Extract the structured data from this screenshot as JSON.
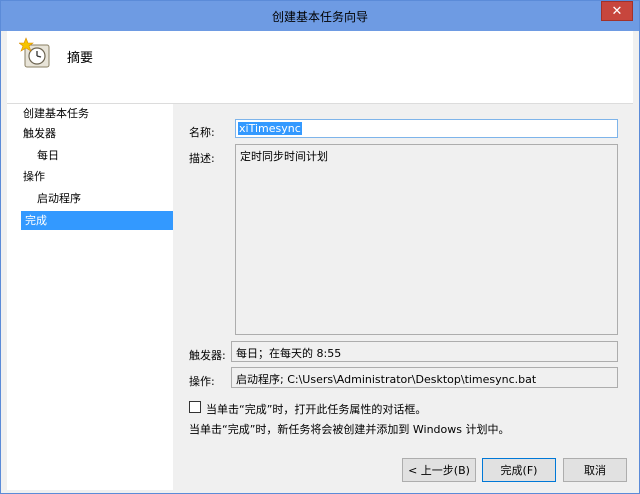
{
  "window": {
    "title": "创建基本任务向导",
    "close_symbol": "✕"
  },
  "header": {
    "title": "摘要",
    "icon": "clock-star-icon"
  },
  "sidebar": {
    "items": [
      {
        "label": "创建基本任务"
      },
      {
        "label": "触发器"
      },
      {
        "label": "每日"
      },
      {
        "label": "操作"
      },
      {
        "label": "启动程序"
      },
      {
        "label": "完成"
      }
    ],
    "selected": "完成"
  },
  "form": {
    "name_label": "名称:",
    "name_value": "xiTimesync",
    "desc_label": "描述:",
    "desc_value": "定时同步时间计划",
    "trigger_label": "触发器:",
    "trigger_value": "每日；在每天的 8:55",
    "action_label": "操作:",
    "action_value": "启动程序; C:\\Users\\Administrator\\Desktop\\timesync.bat",
    "checkbox_label": "当单击“完成”时，打开此任务属性的对话框。",
    "checkbox_checked": false,
    "info_text": "当单击“完成”时，新任务将会被创建并添加到 Windows 计划中。"
  },
  "buttons": {
    "back": "< 上一步(B)",
    "finish": "完成(F)",
    "cancel": "取消"
  }
}
